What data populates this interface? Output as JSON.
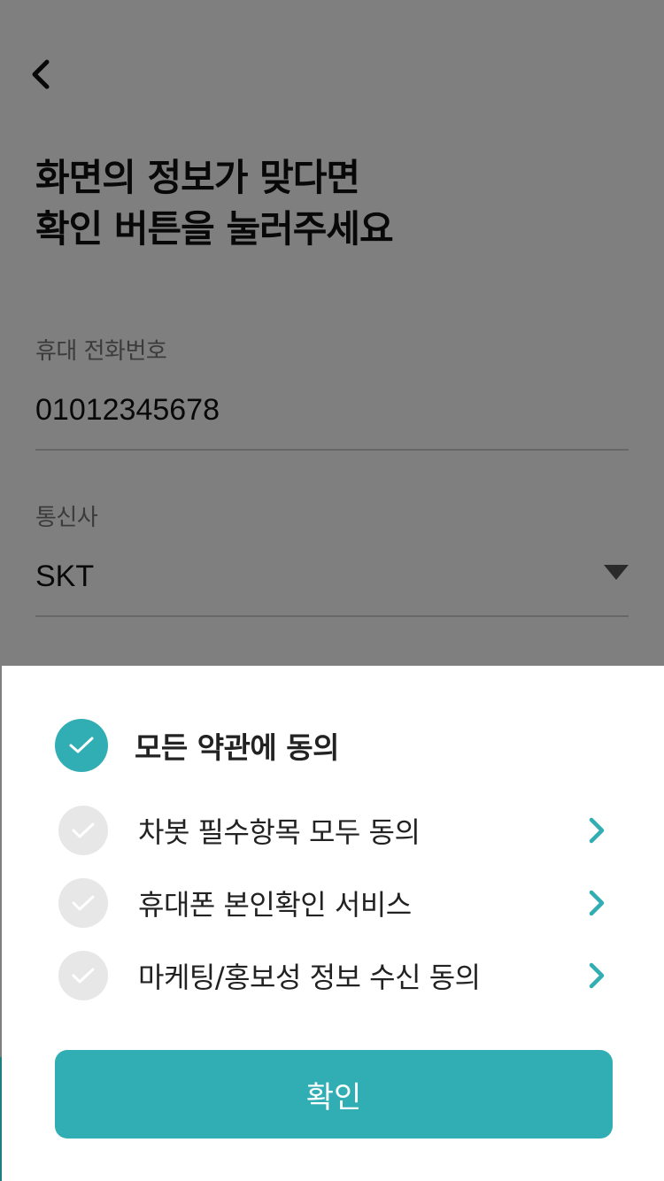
{
  "page": {
    "title_lines": [
      "화면의 정보가 맞다면",
      "확인 버튼을 눌러주세요"
    ],
    "phone": {
      "label": "휴대 전화번호",
      "value": "01012345678"
    },
    "carrier": {
      "label": "통신사",
      "value": "SKT"
    }
  },
  "sheet": {
    "agree_all": {
      "label": "모든 약관에 동의",
      "checked": true
    },
    "items": [
      {
        "label": "차봇 필수항목 모두 동의",
        "checked": false
      },
      {
        "label": "휴대폰 본인확인 서비스",
        "checked": false
      },
      {
        "label": "마케팅/홍보성 정보 수신 동의",
        "checked": false
      }
    ],
    "confirm_label": "확인"
  },
  "colors": {
    "accent": "#31aeb4",
    "unchecked": "#e7e7e7",
    "dim": "rgba(0,0,0,0.5)"
  },
  "icons": {
    "back": "chevron-left-icon",
    "dropdown": "triangle-down-icon",
    "check": "check-icon",
    "arrow": "chevron-right-icon"
  }
}
